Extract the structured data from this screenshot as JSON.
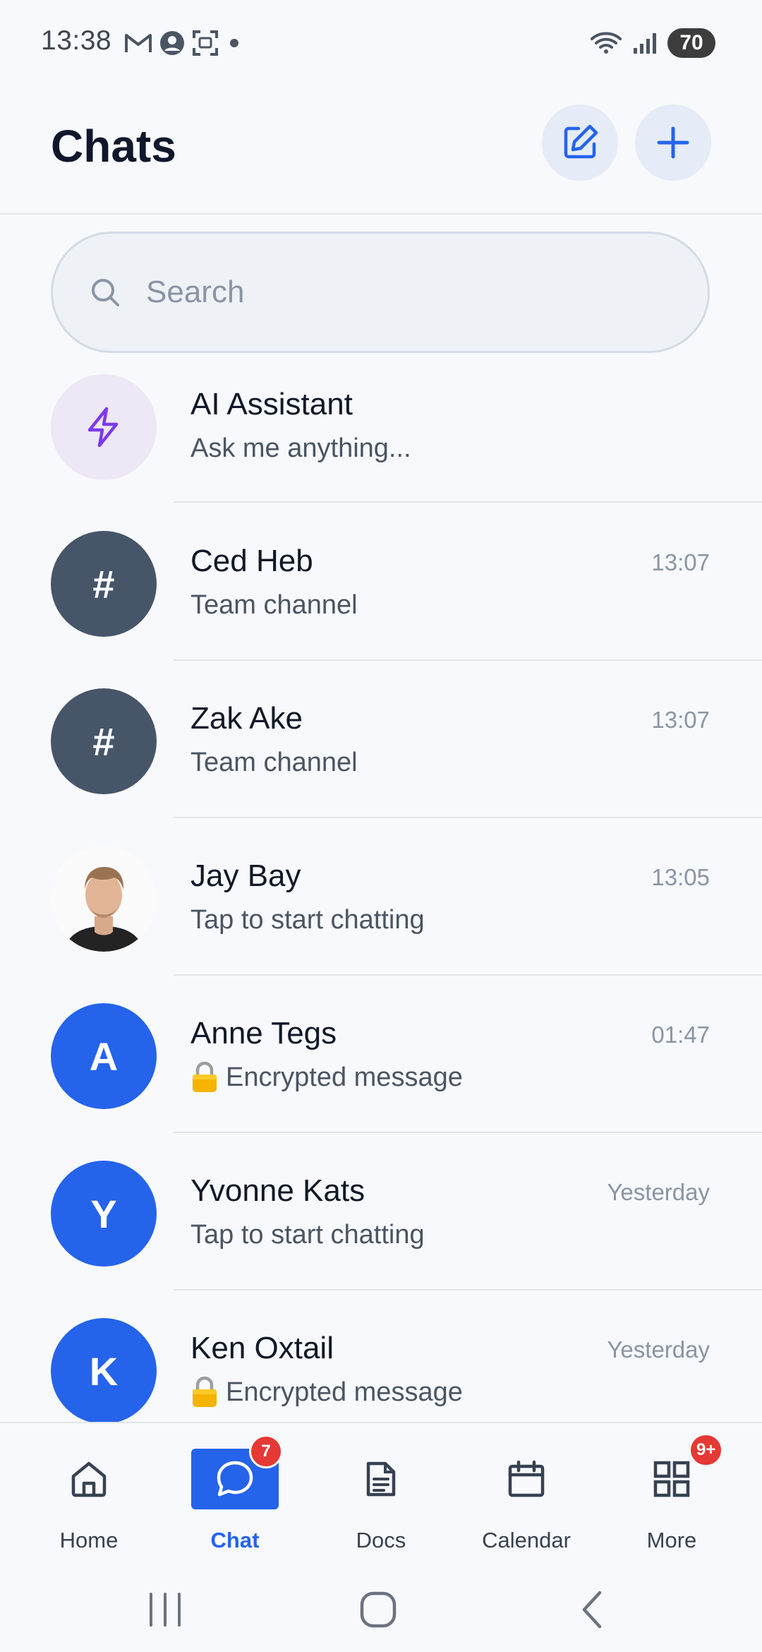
{
  "status_bar": {
    "time": "13:38",
    "left_icons": [
      "gmail-icon",
      "account-circle-icon",
      "screenshot-icon",
      "dot-icon"
    ],
    "right_icons": [
      "wifi-icon",
      "signal-icon"
    ],
    "battery": "70"
  },
  "header": {
    "title": "Chats",
    "compose_icon": "edit-square-icon",
    "add_icon": "plus-icon"
  },
  "search": {
    "placeholder": "Search"
  },
  "chats": [
    {
      "name": "AI Assistant",
      "preview": "Ask me anything...",
      "time": "",
      "avatar_type": "icon",
      "avatar_icon": "lightning-icon",
      "avatar_bg": "#ede7f6",
      "avatar_color": "#7c3aed"
    },
    {
      "name": "Ced Heb",
      "preview": "Team channel",
      "time": "13:07",
      "avatar_type": "text",
      "avatar_text": "#",
      "avatar_bg": "#475569"
    },
    {
      "name": "Zak Ake",
      "preview": "Team channel",
      "time": "13:07",
      "avatar_type": "text",
      "avatar_text": "#",
      "avatar_bg": "#475569"
    },
    {
      "name": "Jay Bay",
      "preview": "Tap to start chatting",
      "time": "13:05",
      "avatar_type": "photo"
    },
    {
      "name": "Anne Tegs",
      "preview": "Encrypted message",
      "preview_icon": "lock-icon",
      "time": "01:47",
      "avatar_type": "text",
      "avatar_text": "A",
      "avatar_bg": "#2563eb"
    },
    {
      "name": "Yvonne Kats",
      "preview": "Tap to start chatting",
      "time": "Yesterday",
      "avatar_type": "text",
      "avatar_text": "Y",
      "avatar_bg": "#2563eb"
    },
    {
      "name": "Ken Oxtail",
      "preview": "Encrypted message",
      "preview_icon": "lock-icon",
      "time": "Yesterday",
      "avatar_type": "text",
      "avatar_text": "K",
      "avatar_bg": "#2563eb"
    }
  ],
  "bottom_nav": [
    {
      "label": "Home",
      "icon": "home-icon",
      "active": false,
      "badge": ""
    },
    {
      "label": "Chat",
      "icon": "chat-bubble-icon",
      "active": true,
      "badge": "7"
    },
    {
      "label": "Docs",
      "icon": "document-icon",
      "active": false,
      "badge": ""
    },
    {
      "label": "Calendar",
      "icon": "calendar-icon",
      "active": false,
      "badge": ""
    },
    {
      "label": "More",
      "icon": "grid-icon",
      "active": false,
      "badge": "9+"
    }
  ],
  "colors": {
    "accent": "#2563eb",
    "background": "#f7f9fc",
    "badge": "#e53935",
    "channel_avatar": "#475569"
  }
}
